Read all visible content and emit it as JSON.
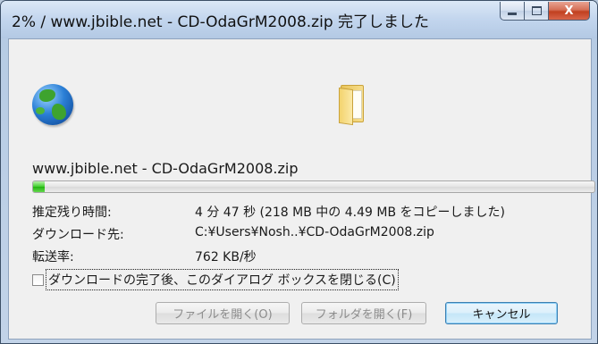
{
  "window": {
    "title": "2% / www.jbible.net - CD-OdaGrM2008.zip 完了しました",
    "close_glyph": "X"
  },
  "icons": {
    "source": "globe-icon",
    "destination": "folder-icon"
  },
  "download": {
    "source_label": "www.jbible.net - CD-OdaGrM2008.zip",
    "progress_percent": 2
  },
  "details": {
    "rows": [
      {
        "key": "推定残り時間:",
        "value": "4 分 47 秒 (218 MB 中の 4.49 MB をコピーしました)"
      },
      {
        "key": "ダウンロード先:",
        "value": "C:¥Users¥Nosh..¥CD-OdaGrM2008.zip"
      },
      {
        "key": "転送率:",
        "value": "762 KB/秒"
      }
    ]
  },
  "options": {
    "close_when_done_label": "ダウンロードの完了後、このダイアログ ボックスを閉じる(C)",
    "close_when_done_checked": false
  },
  "buttons": {
    "open_file": "ファイルを開く(O)",
    "open_folder": "フォルダを開く(F)",
    "cancel": "キャンセル"
  },
  "colors": {
    "progress_green": "#3fcf2c",
    "close_button_red": "#c1401f",
    "default_button_border": "#3c7fb1"
  }
}
